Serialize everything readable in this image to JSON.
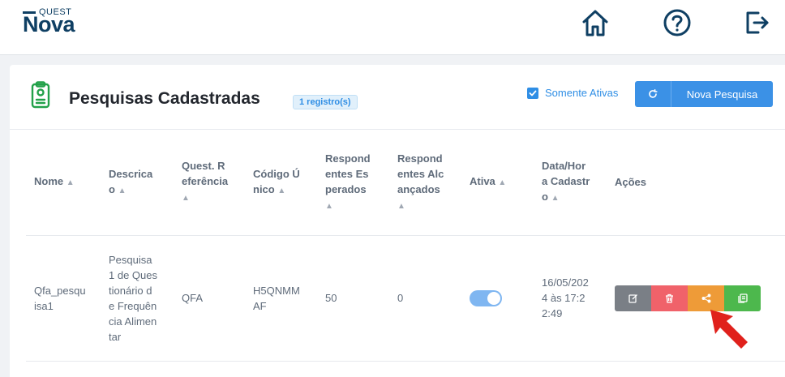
{
  "header": {
    "logo_small": "QUEST",
    "logo_big": "Nova",
    "icons": [
      "home-icon",
      "help-icon",
      "logout-icon"
    ]
  },
  "card": {
    "title": "Pesquisas Cadastradas",
    "count": "1 registro(s)",
    "only_active_label": "Somente Ativas",
    "only_active_checked": true,
    "new_button": "Nova Pesquisa"
  },
  "table": {
    "columns": [
      {
        "label": "Nome",
        "lines": [
          "Nome"
        ]
      },
      {
        "label": "Descricao",
        "lines": [
          "Descrica",
          "o"
        ]
      },
      {
        "label": "Quest. Referência",
        "lines": [
          "Quest. R",
          "eferência"
        ]
      },
      {
        "label": "Código Único",
        "lines": [
          "Código Ú",
          "nico"
        ]
      },
      {
        "label": "Respondentes Esperados",
        "lines": [
          "Respond",
          "entes Es",
          "perados"
        ]
      },
      {
        "label": "Respondentes Alcançados",
        "lines": [
          "Respond",
          "entes Alc",
          "ançados"
        ]
      },
      {
        "label": "Ativa",
        "lines": [
          "Ativa"
        ]
      },
      {
        "label": "Data/Hora Cadastro",
        "lines": [
          "Data/Hor",
          "a Cadastr",
          "o"
        ]
      },
      {
        "label": "Ações",
        "lines": [
          "Ações"
        ]
      }
    ],
    "rows": [
      {
        "nome": [
          "Qfa_pesqu",
          "isa1"
        ],
        "descricao": [
          "Pesquisa",
          "1 de Ques",
          "tionário d",
          "e Frequên",
          "cia Alimen",
          "tar"
        ],
        "quest_ref": "QFA",
        "codigo": [
          "H5QNMM",
          "AF"
        ],
        "esperados": "50",
        "alcancados": "0",
        "ativa": true,
        "data": [
          "16/05/202",
          "4 às 17:2",
          "2:49"
        ]
      }
    ]
  },
  "colors": {
    "primary": "#3b91e6",
    "edit": "#7a7f86",
    "delete": "#f0626a",
    "share": "#ee9b38",
    "copy": "#4db84d",
    "arrow": "#e0211c"
  }
}
